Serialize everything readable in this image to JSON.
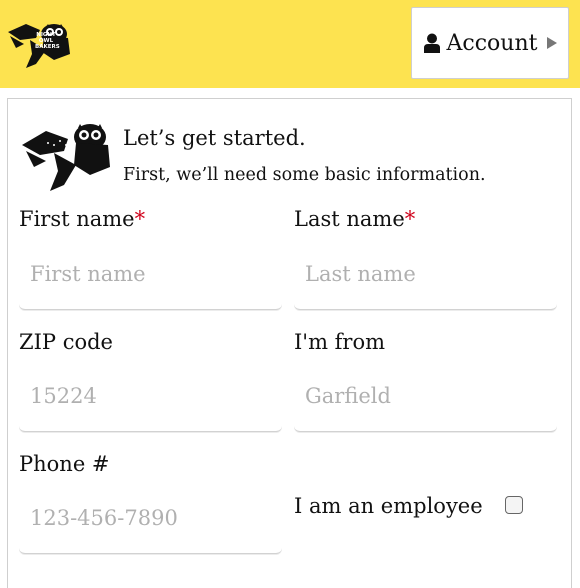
{
  "header": {
    "logo_text": "NIGHT OWL BAKERS",
    "account_label": "Account",
    "icons": {
      "account": "user-icon",
      "caret": "caret-right-icon"
    }
  },
  "intro": {
    "title": "Let’s get started.",
    "subtitle": "First, we’ll need some basic information."
  },
  "form": {
    "first_name": {
      "label": "First name",
      "required_mark": "*",
      "placeholder": "First name",
      "value": ""
    },
    "last_name": {
      "label": "Last name",
      "required_mark": "*",
      "placeholder": "Last name",
      "value": ""
    },
    "zip": {
      "label": "ZIP code",
      "placeholder": "15224",
      "value": ""
    },
    "from": {
      "label": "I'm from",
      "placeholder": "Garfield",
      "value": ""
    },
    "phone": {
      "label": "Phone #",
      "placeholder": "123-456-7890",
      "value": ""
    },
    "employee": {
      "label": "I am an employee",
      "checked": false
    }
  },
  "colors": {
    "accent": "#fde350",
    "required": "#d0021b",
    "placeholder": "#b0b0b0"
  }
}
